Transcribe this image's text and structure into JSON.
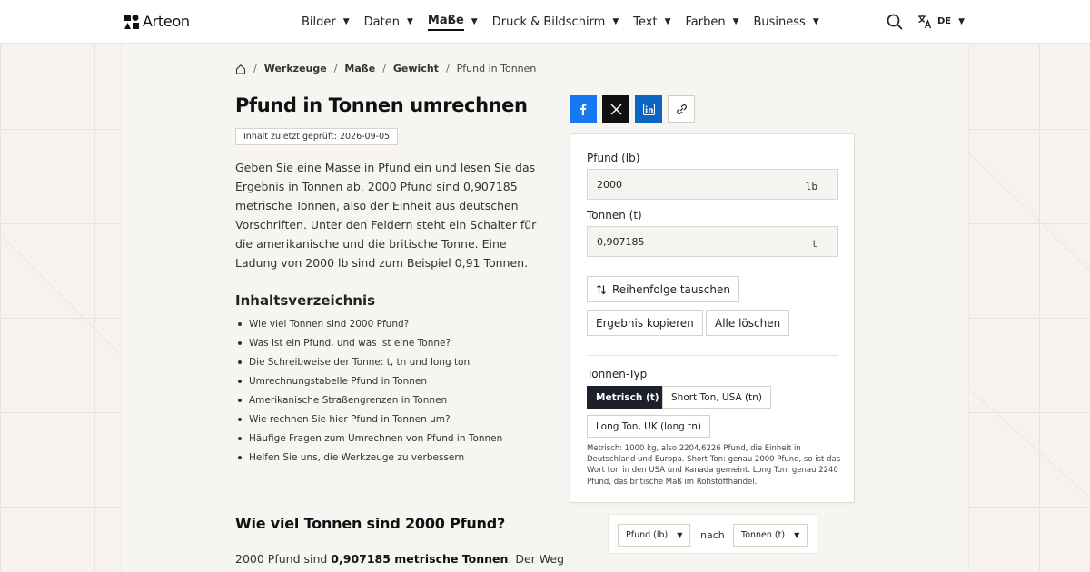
{
  "brand": {
    "name": "Arteon"
  },
  "nav": {
    "items": [
      {
        "label": "Bilder"
      },
      {
        "label": "Daten"
      },
      {
        "label": "Maße",
        "active": true
      },
      {
        "label": "Druck & Bildschirm"
      },
      {
        "label": "Text"
      },
      {
        "label": "Farben"
      },
      {
        "label": "Business"
      }
    ],
    "language": "DE"
  },
  "breadcrumb": {
    "items": [
      "Werkzeuge",
      "Maße",
      "Gewicht"
    ],
    "current": "Pfund in Tonnen"
  },
  "page": {
    "title": "Pfund in Tonnen umrechnen",
    "review_badge": "Inhalt zuletzt geprüft: 2026-09-05",
    "intro": "Geben Sie eine Masse in Pfund ein und lesen Sie das Ergebnis in Tonnen ab. 2000 Pfund sind 0,907185 metrische Tonnen, also der Einheit aus deutschen Vorschriften. Unter den Feldern steht ein Schalter für die amerikanische und die britische Tonne. Eine Ladung von 2000 lb sind zum Beispiel 0,91 Tonnen.",
    "toc_title": "Inhaltsverzeichnis",
    "toc": [
      "Wie viel Tonnen sind 2000 Pfund?",
      "Was ist ein Pfund, und was ist eine Tonne?",
      "Die Schreibweise der Tonne: t, tn und long ton",
      "Umrechnungstabelle Pfund in Tonnen",
      "Amerikanische Straßengrenzen in Tonnen",
      "Wie rechnen Sie hier Pfund in Tonnen um?",
      "Häufige Fragen zum Umrechnen von Pfund in Tonnen",
      "Helfen Sie uns, die Werkzeuge zu verbessern"
    ],
    "section_title": "Wie viel Tonnen sind 2000 Pfund?",
    "answer_prefix": "2000 Pfund sind ",
    "answer_bold": "0,907185 metrische Tonnen",
    "answer_suffix": ". Der Weg"
  },
  "converter": {
    "from_label": "Pfund (lb)",
    "from_value": "2000",
    "from_unit": "lb",
    "to_label": "Tonnen (t)",
    "to_value": "0,907185",
    "to_unit": "t",
    "swap_button": "Reihenfolge tauschen",
    "copy_button": "Ergebnis kopieren",
    "clear_button": "Alle löschen",
    "type_label": "Tonnen-Typ",
    "types": [
      "Metrisch (t)",
      "Short Ton, USA (tn)",
      "Long Ton, UK (long tn)"
    ],
    "selected_type": "Metrisch (t)",
    "hint": "Metrisch: 1000 kg, also 2204,6226 Pfund, die Einheit in Deutschland und Europa. Short Ton: genau 2000 Pfund, so ist das Wort ton in den USA und Kanada gemeint. Long Ton: genau 2240 Pfund, das britische Maß im Rohstoffhandel."
  },
  "chooser": {
    "from": "Pfund (lb)",
    "connector": "nach",
    "to": "Tonnen (t)"
  },
  "colors": {
    "facebook": "#1877f2",
    "x": "#111111",
    "linkedin": "#0a66c2",
    "selected_pill": "#1d1f2b"
  }
}
